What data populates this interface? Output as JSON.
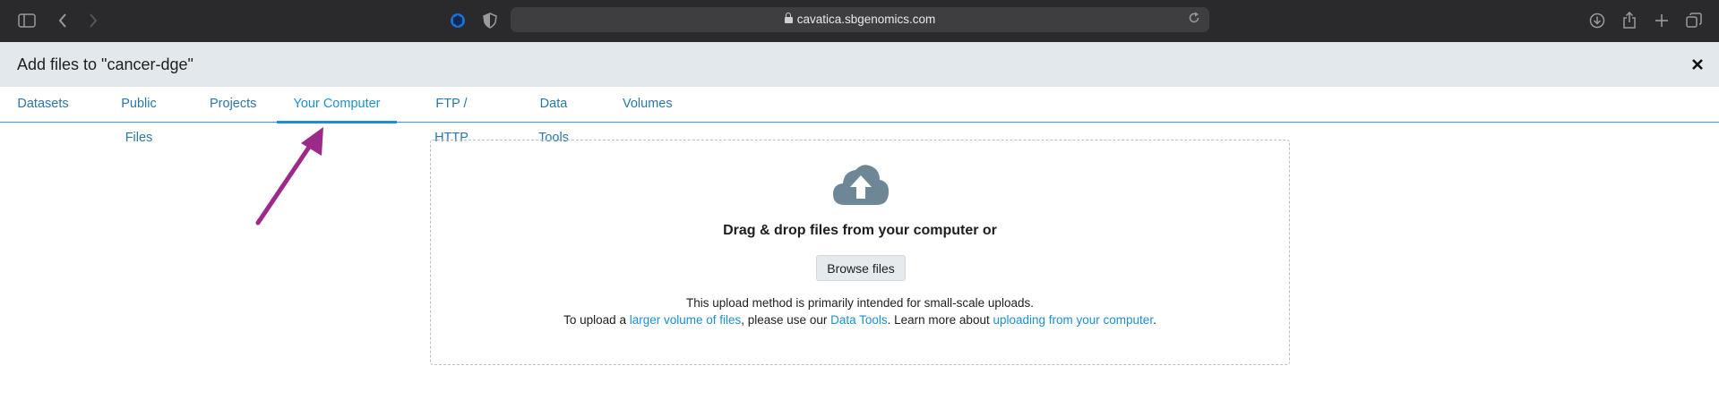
{
  "browser": {
    "url": "cavatica.sbgenomics.com",
    "icons": [
      "sidebar-icon",
      "back-icon",
      "forward-icon",
      "extension-icon",
      "privacy-shield-icon",
      "lock-icon",
      "reload-icon",
      "downloads-icon",
      "share-icon",
      "new-tab-icon",
      "tab-overview-icon"
    ]
  },
  "dialog": {
    "title": "Add files to \"cancer-dge\"",
    "close_icon": "close-icon"
  },
  "tabs": [
    {
      "label": "Datasets",
      "active": false
    },
    {
      "label": "Public Files",
      "active": false
    },
    {
      "label": "Projects",
      "active": false
    },
    {
      "label": "Your Computer",
      "active": true
    },
    {
      "label": "FTP / HTTP",
      "active": false
    },
    {
      "label": "Data Tools",
      "active": false
    },
    {
      "label": "Volumes",
      "active": false
    }
  ],
  "upload": {
    "icon": "cloud-upload-icon",
    "heading": "Drag & drop files from your computer or",
    "browse_label": "Browse files",
    "line1": "This upload method is primarily intended for small-scale uploads.",
    "line2_part1": "To upload a ",
    "line2_link1": "larger volume of files",
    "line2_part2": ", please use our ",
    "line2_link2": "Data Tools",
    "line2_part3": ". Learn more about ",
    "line2_link3": "uploading from your computer",
    "line2_part4": "."
  },
  "colors": {
    "accent": "#1e8fd3",
    "link": "#1b8fd6",
    "annotation": "#9b2a8a",
    "header_bg": "#e3e8ec",
    "icon_gray": "#6e8797"
  }
}
